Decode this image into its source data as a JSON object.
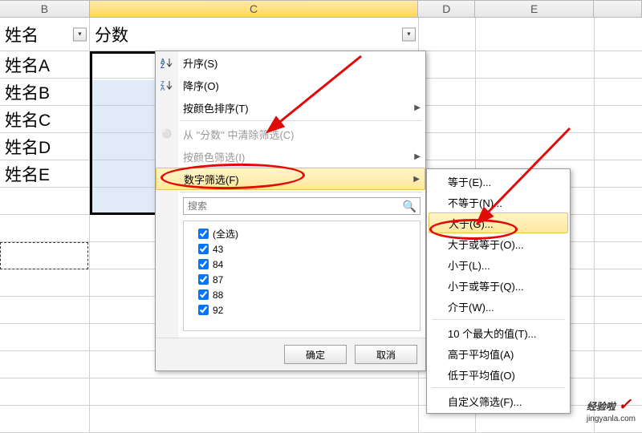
{
  "columns": {
    "b": "B",
    "c": "C",
    "d": "D",
    "e": "E"
  },
  "header_row": {
    "name": "姓名",
    "score": "分数"
  },
  "rows": [
    "姓名A",
    "姓名B",
    "姓名C",
    "姓名D",
    "姓名E"
  ],
  "menu": {
    "sort_asc": "升序(S)",
    "sort_desc": "降序(O)",
    "sort_color": "按颜色排序(T)",
    "clear_filter": "从 \"分数\" 中清除筛选(C)",
    "filter_color": "按颜色筛选(I)",
    "number_filter": "数字筛选(F)",
    "search_placeholder": "搜索",
    "checks": [
      "(全选)",
      "43",
      "84",
      "87",
      "88",
      "92"
    ],
    "ok": "确定",
    "cancel": "取消"
  },
  "submenu": {
    "eq": "等于(E)...",
    "neq": "不等于(N)...",
    "gt": "大于(G)...",
    "gte": "大于或等于(O)...",
    "lt": "小于(L)...",
    "lte": "小于或等于(Q)...",
    "between": "介于(W)...",
    "top10": "10 个最大的值(T)...",
    "above_avg": "高于平均值(A)",
    "below_avg": "低于平均值(O)",
    "custom": "自定义筛选(F)..."
  },
  "watermark": {
    "brand": "经验啦",
    "check": "✓",
    "url": "jingyanla.com"
  },
  "icons": {
    "sort_asc": "A↓",
    "sort_desc": "Z↓",
    "funnel": "▼"
  },
  "chart_data": {
    "type": "table",
    "title": "分数",
    "categories": [
      "姓名A",
      "姓名B",
      "姓名C",
      "姓名D",
      "姓名E"
    ],
    "filter_values": [
      43,
      84,
      87,
      88,
      92
    ]
  }
}
